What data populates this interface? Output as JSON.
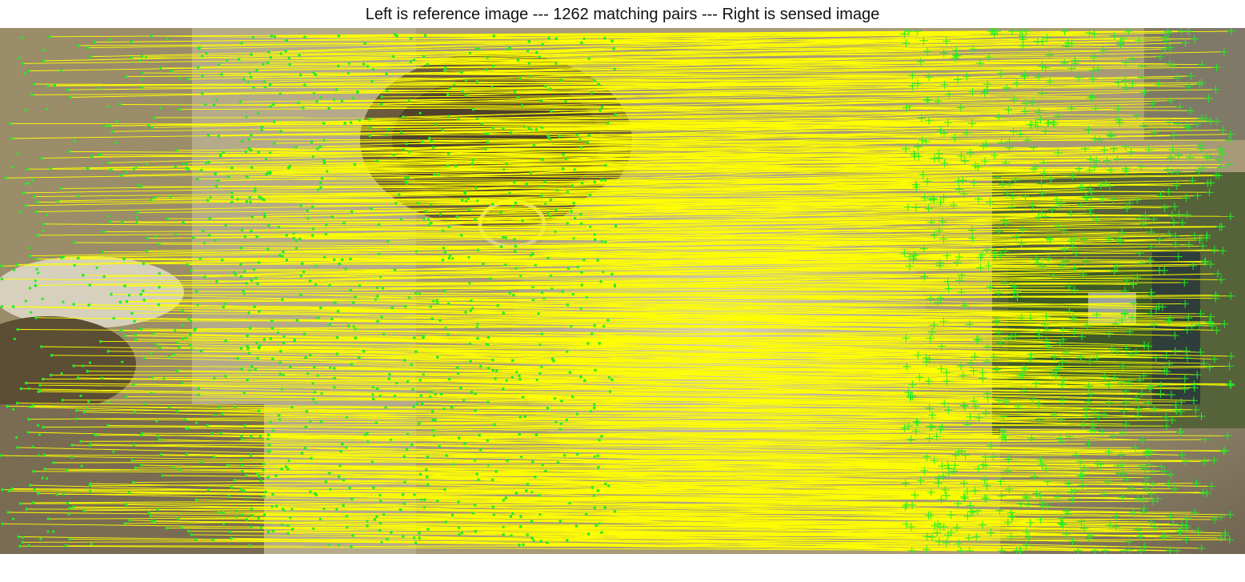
{
  "title": "Left is reference image --- 1262 matching pairs --- Right is sensed image",
  "match_count": 1262,
  "colors": {
    "match_line": "#ffff00",
    "reference_point": "#22ee22",
    "sensed_point": "#22ee22",
    "background": "#ffffff"
  },
  "icons": {
    "reference_point": "dot-marker",
    "sensed_point": "plus-marker"
  }
}
